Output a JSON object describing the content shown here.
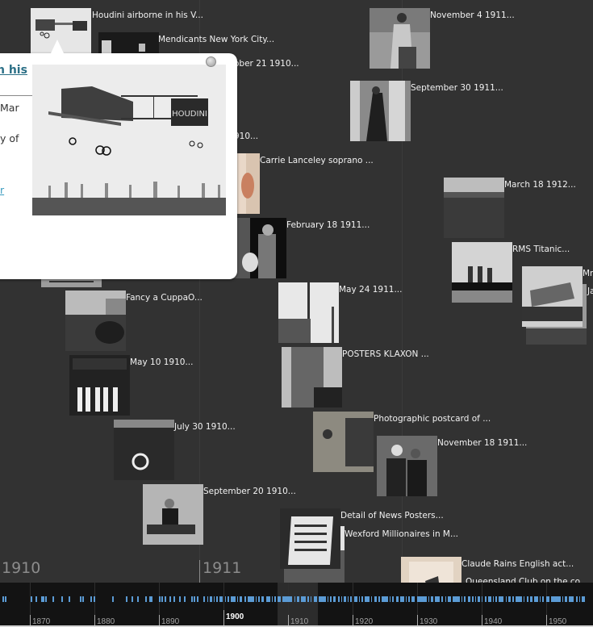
{
  "timeline": {
    "era_labels": [
      "1910",
      "1911"
    ],
    "events": [
      {
        "label": "Houdini airborne in his V...",
        "thumb": "airplane"
      },
      {
        "label": "Mendicants New York City...",
        "thumb": "dark-street"
      },
      {
        "label": "ober 21 1910...",
        "thumb": "none"
      },
      {
        "label": "910...",
        "thumb": "none"
      },
      {
        "label": "Carrie Lanceley soprano ...",
        "thumb": "sepia-portrait"
      },
      {
        "label": "February 18 1911...",
        "thumb": "man-dog"
      },
      {
        "label": "November 4 1911...",
        "thumb": "woman-chair"
      },
      {
        "label": "September 30 1911...",
        "thumb": "woman-gown"
      },
      {
        "label": "March 18 1912...",
        "thumb": "crowd"
      },
      {
        "label": "RMS Titanic...",
        "thumb": "ship"
      },
      {
        "label": "Mr",
        "thumb": "machine"
      },
      {
        "label": "Ja",
        "thumb": "none"
      },
      {
        "label": "Fancy a CuppaO...",
        "thumb": "cattle-market"
      },
      {
        "label": "May 10 1910...",
        "thumb": "shopfront"
      },
      {
        "label": "May 24 1911...",
        "thumb": "street-pole"
      },
      {
        "label": "POSTERS KLAXON ...",
        "thumb": "building"
      },
      {
        "label": "July 30 1910...",
        "thumb": "crew-group"
      },
      {
        "label": "Photographic postcard of ...",
        "thumb": "piano-ladies"
      },
      {
        "label": "November 18 1911...",
        "thumb": "couple"
      },
      {
        "label": "September 20 1910...",
        "thumb": "child"
      },
      {
        "label": "Detail of News Posters...",
        "thumb": "news-posters"
      },
      {
        "label": "Wexford Millionaires in M...",
        "thumb": "none"
      },
      {
        "label": "Claude Rains English act...",
        "thumb": "actor"
      },
      {
        "label": "Queensland Club on the co",
        "thumb": "none"
      }
    ]
  },
  "popup": {
    "title": "n his",
    "text_lines": [
      "Mar",
      "y of"
    ],
    "link": "r",
    "image": "airplane-houdini",
    "close_icon": "close-icon"
  },
  "navigator": {
    "decade_labels": [
      "1870",
      "1880",
      "1890",
      "1900",
      "1910",
      "1920",
      "1930",
      "1940",
      "1950"
    ],
    "highlighted": "1900",
    "marker_color": "#5b9bd5"
  }
}
